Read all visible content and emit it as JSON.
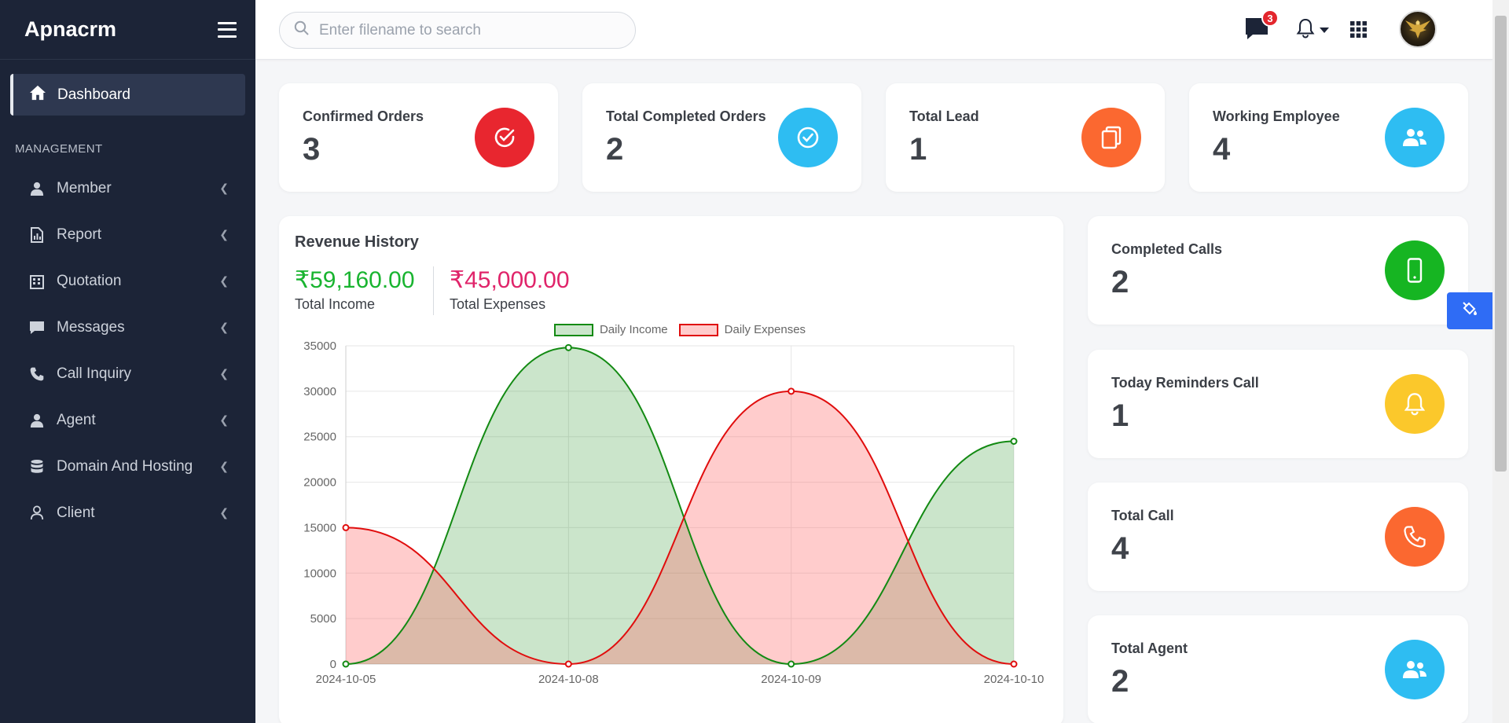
{
  "sidebar": {
    "brand": "Apnacrm",
    "active_item": "Dashboard",
    "section_title": "MANAGEMENT",
    "items": [
      {
        "label": "Member",
        "icon": "user-icon"
      },
      {
        "label": "Report",
        "icon": "report-icon"
      },
      {
        "label": "Quotation",
        "icon": "building-icon"
      },
      {
        "label": "Messages",
        "icon": "message-icon"
      },
      {
        "label": "Call Inquiry",
        "icon": "phone-icon"
      },
      {
        "label": "Agent",
        "icon": "user-icon"
      },
      {
        "label": "Domain And Hosting",
        "icon": "database-icon"
      },
      {
        "label": "Client",
        "icon": "user-outline-icon"
      }
    ]
  },
  "topbar": {
    "search_placeholder": "Enter filename to search",
    "messages_count": "3"
  },
  "stats": [
    {
      "title": "Confirmed Orders",
      "value": "3",
      "color": "#e8262f",
      "icon": "check-circle-icon"
    },
    {
      "title": "Total Completed Orders",
      "value": "2",
      "color": "#2ebdf2",
      "icon": "check-circle-icon"
    },
    {
      "title": "Total Lead",
      "value": "1",
      "color": "#fb6830",
      "icon": "copy-icon"
    },
    {
      "title": "Working Employee",
      "value": "4",
      "color": "#2ebdf2",
      "icon": "users-icon"
    }
  ],
  "side_stats": [
    {
      "title": "Completed Calls",
      "value": "2",
      "color": "#16b522",
      "icon": "mobile-icon"
    },
    {
      "title": "Today Reminders Call",
      "value": "1",
      "color": "#fbc82b",
      "icon": "bell-icon"
    },
    {
      "title": "Total Call",
      "value": "4",
      "color": "#fb6830",
      "icon": "phone-icon"
    },
    {
      "title": "Total Agent",
      "value": "2",
      "color": "#2ebdf2",
      "icon": "users-icon"
    }
  ],
  "revenue": {
    "title": "Revenue History",
    "income": "₹59,160.00",
    "income_label": "Total Income",
    "expenses": "₹45,000.00",
    "expenses_label": "Total Expenses",
    "income_color": "#19b430",
    "expenses_color": "#e0246a"
  },
  "chart_data": {
    "type": "line",
    "categories": [
      "2024-10-05",
      "2024-10-08",
      "2024-10-09",
      "2024-10-10"
    ],
    "series": [
      {
        "name": "Daily Income",
        "values": [
          0,
          34800,
          0,
          24500
        ],
        "color": "#138a13",
        "fill": "rgba(19,138,19,0.22)"
      },
      {
        "name": "Daily Expenses",
        "values": [
          15000,
          0,
          30000,
          0
        ],
        "color": "#e00d0d",
        "fill": "rgba(255,99,99,0.33)"
      }
    ],
    "ylim": [
      0,
      35000
    ],
    "yticks": [
      0,
      5000,
      10000,
      15000,
      20000,
      25000,
      30000,
      35000
    ],
    "grid": true,
    "legend": "top-center",
    "area": true
  }
}
